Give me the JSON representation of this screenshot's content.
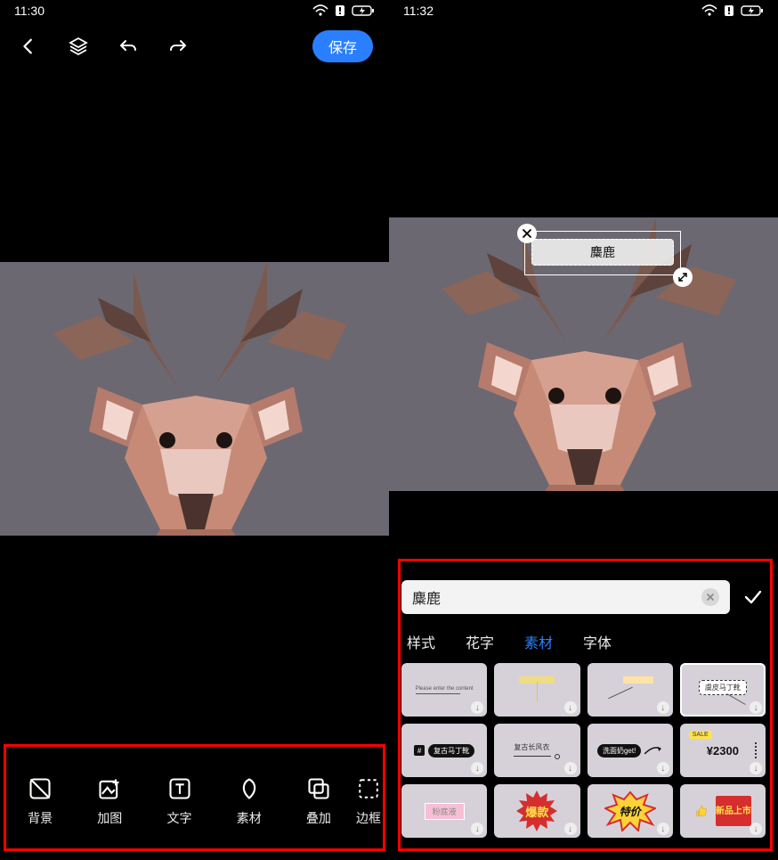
{
  "left": {
    "time": "11:30",
    "save_label": "保存",
    "tools": {
      "background": "背景",
      "add_image": "加图",
      "text": "文字",
      "material": "素材",
      "overlay": "叠加",
      "border": "边框"
    }
  },
  "right": {
    "time": "11:32",
    "overlay_text": "麋鹿",
    "text_input": "麋鹿",
    "tabs": {
      "style": "样式",
      "fancy": "花字",
      "material": "素材",
      "font": "字体"
    },
    "stickers": {
      "r1c1_placeholder": "Please enter the content",
      "r1c4_label": "虞皮马丁靴",
      "r2c1_label": "复古马丁靴",
      "r2c2_label": "复古长风衣",
      "r2c3_label": "洗面奶get!",
      "r2c4_sale": "SALE",
      "r2c4_price": "¥2300",
      "r3c1_label": "粉底液",
      "r3c2_label": "爆款",
      "r3c3_label": "特价",
      "r3c4_label": "新品上市"
    }
  }
}
